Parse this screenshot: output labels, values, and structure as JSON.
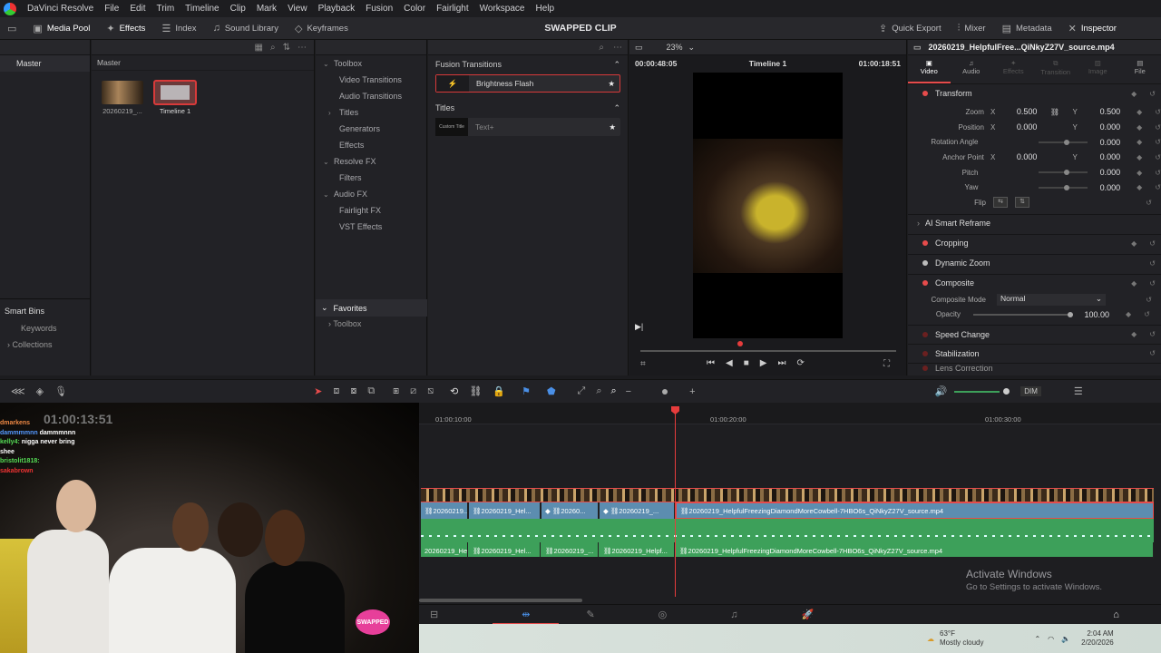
{
  "menu": {
    "app": "DaVinci Resolve",
    "items": [
      "File",
      "Edit",
      "Trim",
      "Timeline",
      "Clip",
      "Mark",
      "View",
      "Playback",
      "Fusion",
      "Color",
      "Fairlight",
      "Workspace",
      "Help"
    ]
  },
  "toolbar": {
    "media_pool": "Media Pool",
    "effects": "Effects",
    "index": "Index",
    "sound_library": "Sound Library",
    "keyframes": "Keyframes",
    "title": "SWAPPED CLIP",
    "quick_export": "Quick Export",
    "mixer": "Mixer",
    "metadata": "Metadata",
    "inspector": "Inspector"
  },
  "bins": {
    "master_left": "Master",
    "master_right": "Master",
    "smart_bins": "Smart Bins",
    "keywords": "Keywords",
    "collections": "Collections"
  },
  "media": [
    {
      "label": "20260219_..."
    },
    {
      "label": "Timeline 1"
    }
  ],
  "effects_tree": {
    "toolbox": "Toolbox",
    "video_transitions": "Video Transitions",
    "audio_transitions": "Audio Transitions",
    "titles": "Titles",
    "generators": "Generators",
    "effects": "Effects",
    "resolve_fx": "Resolve FX",
    "filters": "Filters",
    "audio_fx": "Audio FX",
    "fairlight_fx": "Fairlight FX",
    "vst_effects": "VST Effects",
    "favorites": "Favorites",
    "fav_toolbox": "Toolbox"
  },
  "fusion": {
    "header": "Fusion Transitions",
    "item": "Brightness Flash",
    "titles_header": "Titles",
    "title_thumb": "Custom Title",
    "title_item": "Text+"
  },
  "viewer": {
    "zoom": "23%",
    "timecode_left": "00:00:48:05",
    "timeline_name": "Timeline 1",
    "timecode_right": "01:00:18:51"
  },
  "inspector": {
    "file": "20260219_HelpfulFree...QiNkyZ27V_source.mp4",
    "tabs": [
      "Video",
      "Audio",
      "Effects",
      "Transition",
      "Image",
      "File"
    ],
    "transform": "Transform",
    "zoom": "Zoom",
    "zoom_x": "0.500",
    "zoom_y": "0.500",
    "position": "Position",
    "pos_x": "0.000",
    "pos_y": "0.000",
    "rotation": "Rotation Angle",
    "rotation_v": "0.000",
    "anchor": "Anchor Point",
    "anchor_x": "0.000",
    "anchor_y": "0.000",
    "pitch": "Pitch",
    "pitch_v": "0.000",
    "yaw": "Yaw",
    "yaw_v": "0.000",
    "flip": "Flip",
    "smart_reframe": "AI Smart Reframe",
    "cropping": "Cropping",
    "dynamic_zoom": "Dynamic Zoom",
    "composite": "Composite",
    "composite_mode": "Composite Mode",
    "composite_mode_v": "Normal",
    "opacity": "Opacity",
    "opacity_v": "100.00",
    "speed_change": "Speed Change",
    "stabilization": "Stabilization",
    "lens_correction": "Lens Correction",
    "x": "X",
    "y": "Y"
  },
  "timeline": {
    "ruler": [
      "01:00:10:00",
      "01:00:20:00",
      "01:00:30:00"
    ],
    "dim": "DIM",
    "stream_tc": "01:00:13:51",
    "video_clips": [
      "20260219...",
      "20260219_Hel...",
      "20260...",
      "20260219_...",
      "20260219_HelpfulFreezingDiamondMoreCowbell-7HBO6s_QiNkyZ27V_source.mp4"
    ],
    "audio_clips": [
      "20260219_He...",
      "20260219_Hel...",
      "20260219_...",
      "20260219_Helpf...",
      "20260219_HelpfulFreezingDiamondMoreCowbell-7HBO6s_QiNkyZ27V_source.mp4"
    ]
  },
  "overlay": {
    "chat": [
      {
        "user": "dmarkens",
        "msg": ""
      },
      {
        "user": "dammmmnn",
        "msg": "dammmnnn"
      },
      {
        "user": "kelly4:",
        "msg": "nigga never bring"
      },
      {
        "user": "",
        "msg": "shee"
      },
      {
        "user": "bristolit1818:",
        "msg": ""
      },
      {
        "user": "sakabrown",
        "msg": ""
      }
    ],
    "watermark": "Activate Windows",
    "watermark_sub": "Go to Settings to activate Windows.",
    "badge": "SWAPPED"
  },
  "taskbar": {
    "temp": "63°F",
    "weather": "Mostly cloudy",
    "time": "2:04 AM",
    "date": "2/20/2026"
  },
  "colors": {
    "accent": "#e64b4b",
    "video_clip": "#5c8db0",
    "audio_clip": "#3da05a",
    "playhead": "#e63c3c"
  }
}
